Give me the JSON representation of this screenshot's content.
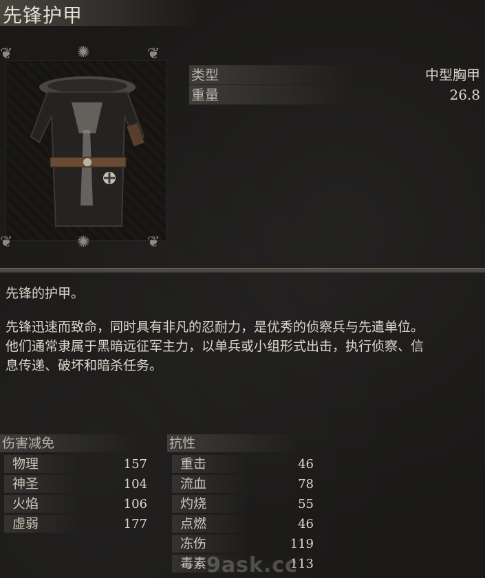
{
  "item": {
    "name": "先锋护甲",
    "type_label": "类型",
    "type_value": "中型胸甲",
    "weight_label": "重量",
    "weight_value": "26.8"
  },
  "description": {
    "line1": "先锋的护甲。",
    "line2": "先锋迅速而致命，同时具有非凡的忍耐力，是优秀的侦察兵与先遣单位。",
    "line3": "他们通常隶属于黑暗远征军主力，以单兵或小组形式出击，执行侦察、信",
    "line4": "息传递、破坏和暗杀任务。"
  },
  "damage_negation": {
    "header": "伤害减免",
    "rows": [
      {
        "label": "物理",
        "value": "157"
      },
      {
        "label": "神圣",
        "value": "104"
      },
      {
        "label": "火焰",
        "value": "106"
      },
      {
        "label": "虚弱",
        "value": "177"
      }
    ]
  },
  "resistance": {
    "header": "抗性",
    "rows": [
      {
        "label": "重击",
        "value": "46"
      },
      {
        "label": "流血",
        "value": "78"
      },
      {
        "label": "灼烧",
        "value": "55"
      },
      {
        "label": "点燃",
        "value": "46"
      },
      {
        "label": "冻伤",
        "value": "119"
      },
      {
        "label": "毒素",
        "value": "113"
      }
    ]
  },
  "watermark": "9ask.cc",
  "colors": {
    "background": "#1a1918",
    "text": "#ddd7cb",
    "label_band": "#5a5854"
  }
}
